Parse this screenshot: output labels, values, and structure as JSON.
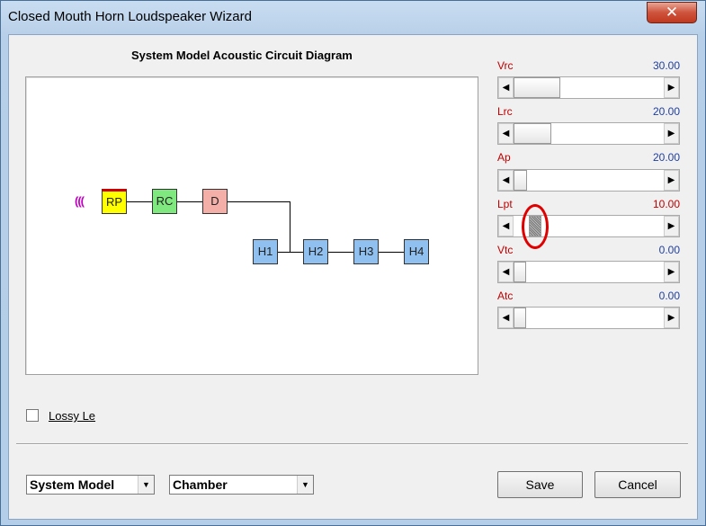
{
  "window": {
    "title": "Closed Mouth Horn Loudspeaker Wizard",
    "close_glyph": "✕"
  },
  "diagram": {
    "title": "System Model Acoustic Circuit Diagram",
    "source_symbol": "(((",
    "nodes": [
      {
        "id": "rp",
        "label": "RP",
        "color": "#ffff00",
        "accent": "#cc0000"
      },
      {
        "id": "rc",
        "label": "RC",
        "color": "#7fe87f"
      },
      {
        "id": "d",
        "label": "D",
        "color": "#f4b0a8"
      },
      {
        "id": "h1",
        "label": "H1",
        "color": "#8fc0ef"
      },
      {
        "id": "h2",
        "label": "H2",
        "color": "#8fc0ef"
      },
      {
        "id": "h3",
        "label": "H3",
        "color": "#8fc0ef"
      },
      {
        "id": "h4",
        "label": "H4",
        "color": "#8fc0ef"
      }
    ]
  },
  "sliders": [
    {
      "label": "Vrc",
      "value": "30.00",
      "value_color": "#2040a0",
      "position": 0.3
    },
    {
      "label": "Lrc",
      "value": "20.00",
      "value_color": "#2040a0",
      "position": 0.2
    },
    {
      "label": "Ap",
      "value": "20.00",
      "value_color": "#2040a0",
      "position": 0.02
    },
    {
      "label": "Lpt",
      "value": "10.00",
      "value_color": "#c00000",
      "position": 0.05
    },
    {
      "label": "Vtc",
      "value": "0.00",
      "value_color": "#2040a0",
      "position": 0.0
    },
    {
      "label": "Atc",
      "value": "0.00",
      "value_color": "#2040a0",
      "position": 0.0
    }
  ],
  "scroll_arrows": {
    "left": "◀",
    "right": "▶"
  },
  "lossy": {
    "label": "Lossy Le",
    "checked": false
  },
  "model_select": {
    "value": "System Model",
    "arrow": "▼"
  },
  "chamber_select": {
    "value": "Chamber",
    "arrow": "▼"
  },
  "buttons": {
    "save": "Save",
    "cancel": "Cancel"
  },
  "highlight_color": "#e00000"
}
